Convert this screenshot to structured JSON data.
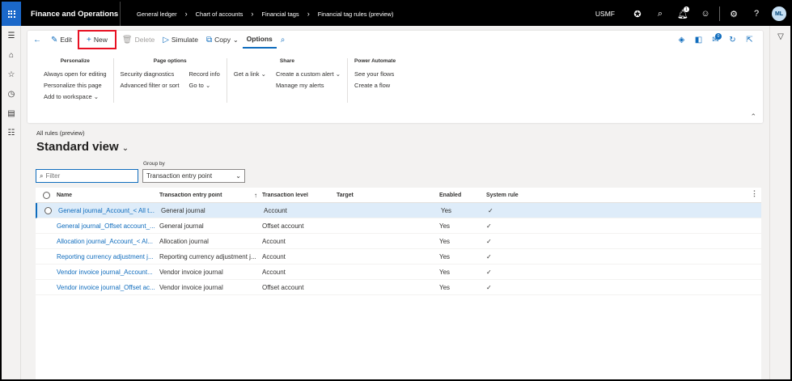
{
  "topbar": {
    "app_title": "Finance and Operations",
    "breadcrumbs": [
      "General ledger",
      "Chart of accounts",
      "Financial tags",
      "Financial tag rules (preview)"
    ],
    "company": "USMF",
    "notification_count": "1",
    "avatar_initials": "ML"
  },
  "actions": {
    "edit": "Edit",
    "new": "New",
    "delete": "Delete",
    "simulate": "Simulate",
    "copy": "Copy",
    "options": "Options",
    "badge_count": "0"
  },
  "option_groups": {
    "personalize": {
      "title": "Personalize",
      "items": [
        "Always open for editing",
        "Personalize this page",
        "Add to workspace"
      ]
    },
    "page_options": {
      "title": "Page options",
      "col1": [
        "Security diagnostics",
        "Advanced filter or sort"
      ],
      "col2": [
        "Record info",
        "Go to"
      ]
    },
    "share": {
      "title": "Share",
      "col1": [
        "Get a link"
      ],
      "col2": [
        "Create a custom alert",
        "Manage my alerts"
      ]
    },
    "power_automate": {
      "title": "Power Automate",
      "items": [
        "See your flows",
        "Create a flow"
      ]
    }
  },
  "main": {
    "subheading": "All rules (preview)",
    "view_name": "Standard view",
    "filter_placeholder": "Filter",
    "group_by_label": "Group by",
    "group_by_value": "Transaction entry point"
  },
  "grid": {
    "columns": {
      "name": "Name",
      "entry_point": "Transaction entry point",
      "level": "Transaction level",
      "target": "Target",
      "enabled": "Enabled",
      "system_rule": "System rule"
    },
    "rows": [
      {
        "name": "General journal_Account_< All t...",
        "entry_point": "General journal",
        "level": "Account",
        "target": "",
        "enabled": "Yes",
        "system_rule": "✓"
      },
      {
        "name": "General journal_Offset account_...",
        "entry_point": "General journal",
        "level": "Offset account",
        "target": "",
        "enabled": "Yes",
        "system_rule": "✓"
      },
      {
        "name": "Allocation journal_Account_< Al...",
        "entry_point": "Allocation journal",
        "level": "Account",
        "target": "",
        "enabled": "Yes",
        "system_rule": "✓"
      },
      {
        "name": "Reporting currency adjustment j...",
        "entry_point": "Reporting currency adjustment j...",
        "level": "Account",
        "target": "",
        "enabled": "Yes",
        "system_rule": "✓"
      },
      {
        "name": "Vendor invoice journal_Account...",
        "entry_point": "Vendor invoice journal",
        "level": "Account",
        "target": "",
        "enabled": "Yes",
        "system_rule": "✓"
      },
      {
        "name": "Vendor invoice journal_Offset ac...",
        "entry_point": "Vendor invoice journal",
        "level": "Offset account",
        "target": "",
        "enabled": "Yes",
        "system_rule": "✓"
      }
    ]
  },
  "colors": {
    "accent": "#0f6cbd",
    "waffle": "#1b68c9",
    "highlight_box": "#e81123",
    "selected_row": "#deecf9"
  }
}
